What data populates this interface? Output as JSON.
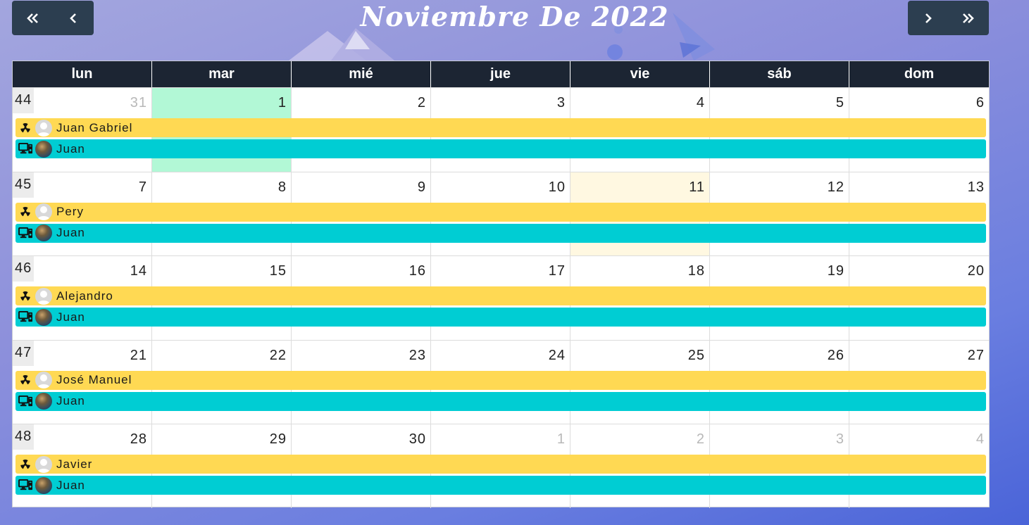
{
  "header": {
    "title": "Noviembre De 2022",
    "prev_year_icon": "double-chevron-left-icon",
    "prev_month_icon": "chevron-left-icon",
    "next_month_icon": "chevron-right-icon",
    "next_year_icon": "double-chevron-right-icon"
  },
  "weekdays": [
    "lun",
    "mar",
    "mié",
    "jue",
    "vie",
    "sáb",
    "dom"
  ],
  "colors": {
    "header_bg": "#1c2533",
    "nav_bg": "#2c3e50",
    "today_bg": "#b2f8d6",
    "highlight_bg": "#fff8e1",
    "event_yellow": "#ffd953",
    "event_cyan": "#00cdd3"
  },
  "weeks": [
    {
      "number": "44",
      "days": [
        {
          "num": "31",
          "other": true
        },
        {
          "num": "1",
          "today": true
        },
        {
          "num": "2"
        },
        {
          "num": "3"
        },
        {
          "num": "4"
        },
        {
          "num": "5"
        },
        {
          "num": "6"
        }
      ],
      "events": [
        {
          "type": "yellow",
          "icon": "radiation-icon",
          "avatar": "person",
          "label": "Juan Gabriel"
        },
        {
          "type": "cyan",
          "icon": "computer-icon",
          "avatar": "photo",
          "label": "Juan"
        }
      ]
    },
    {
      "number": "45",
      "days": [
        {
          "num": "7"
        },
        {
          "num": "8"
        },
        {
          "num": "9"
        },
        {
          "num": "10"
        },
        {
          "num": "11",
          "highlight": true
        },
        {
          "num": "12"
        },
        {
          "num": "13"
        }
      ],
      "events": [
        {
          "type": "yellow",
          "icon": "radiation-icon",
          "avatar": "person",
          "label": "Pery"
        },
        {
          "type": "cyan",
          "icon": "computer-icon",
          "avatar": "photo",
          "label": "Juan"
        }
      ]
    },
    {
      "number": "46",
      "days": [
        {
          "num": "14"
        },
        {
          "num": "15"
        },
        {
          "num": "16"
        },
        {
          "num": "17"
        },
        {
          "num": "18"
        },
        {
          "num": "19"
        },
        {
          "num": "20"
        }
      ],
      "events": [
        {
          "type": "yellow",
          "icon": "radiation-icon",
          "avatar": "person",
          "label": "Alejandro"
        },
        {
          "type": "cyan",
          "icon": "computer-icon",
          "avatar": "photo",
          "label": "Juan"
        }
      ]
    },
    {
      "number": "47",
      "days": [
        {
          "num": "21"
        },
        {
          "num": "22"
        },
        {
          "num": "23"
        },
        {
          "num": "24"
        },
        {
          "num": "25"
        },
        {
          "num": "26"
        },
        {
          "num": "27"
        }
      ],
      "events": [
        {
          "type": "yellow",
          "icon": "radiation-icon",
          "avatar": "person",
          "label": "José Manuel"
        },
        {
          "type": "cyan",
          "icon": "computer-icon",
          "avatar": "photo",
          "label": "Juan"
        }
      ]
    },
    {
      "number": "48",
      "days": [
        {
          "num": "28"
        },
        {
          "num": "29"
        },
        {
          "num": "30"
        },
        {
          "num": "1",
          "other": true
        },
        {
          "num": "2",
          "other": true
        },
        {
          "num": "3",
          "other": true
        },
        {
          "num": "4",
          "other": true
        }
      ],
      "events": [
        {
          "type": "yellow",
          "icon": "radiation-icon",
          "avatar": "person",
          "label": "Javier"
        },
        {
          "type": "cyan",
          "icon": "computer-icon",
          "avatar": "photo",
          "label": "Juan"
        }
      ]
    }
  ]
}
